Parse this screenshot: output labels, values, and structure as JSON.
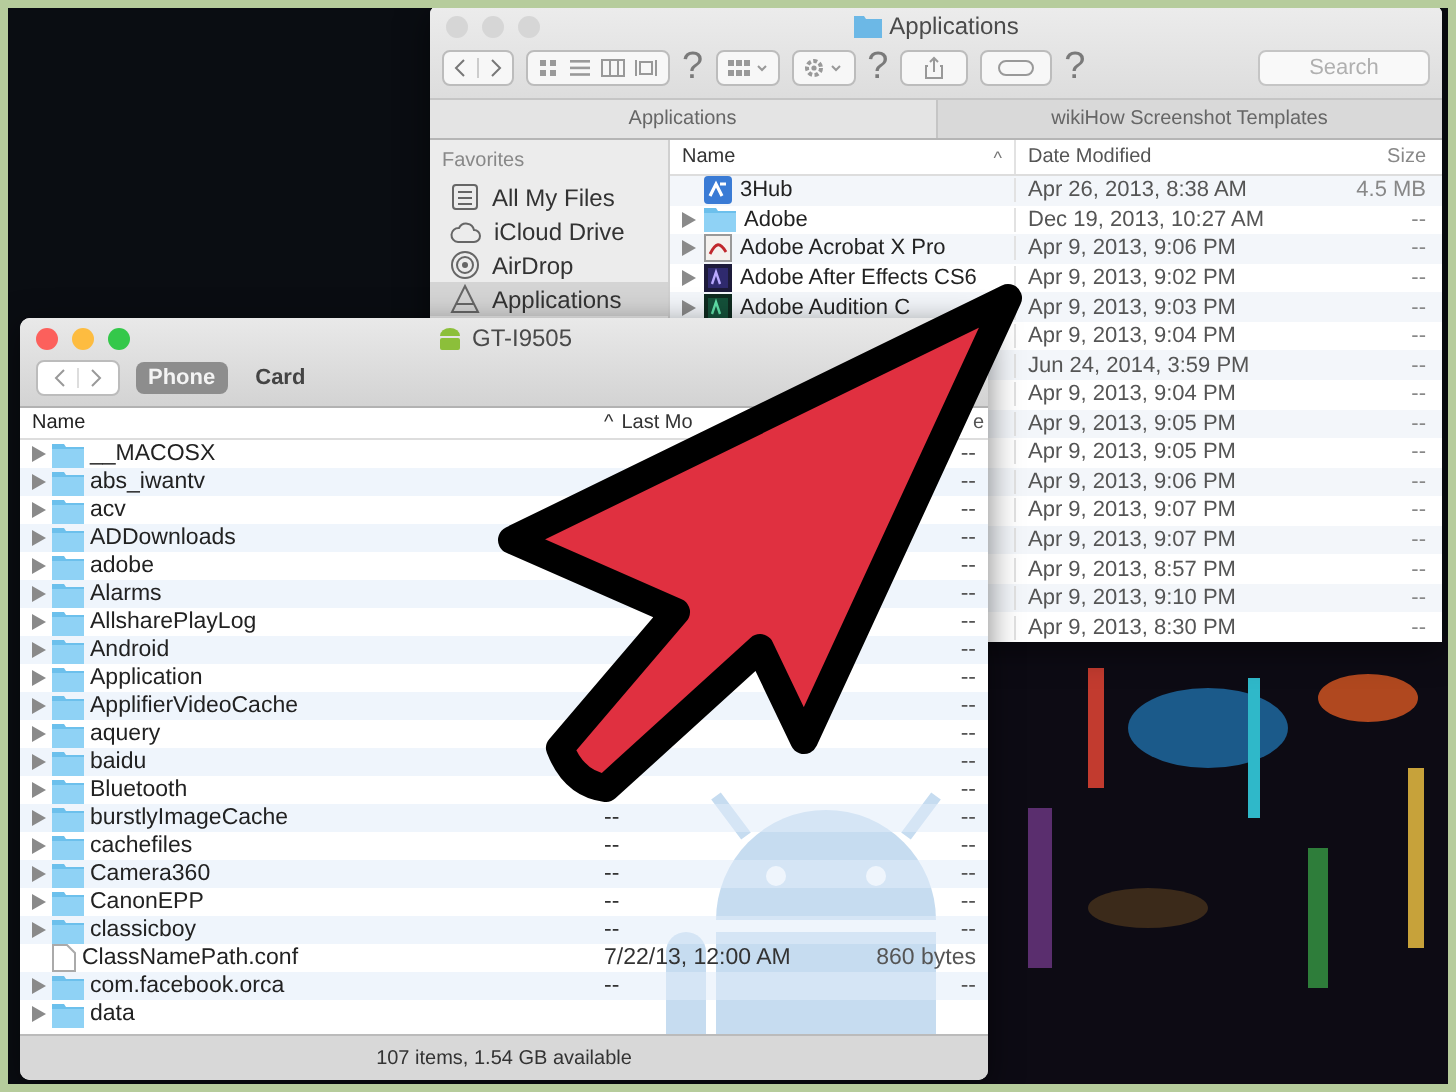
{
  "finder": {
    "title": "Applications",
    "toolbar": [
      {
        "kind": "nav"
      },
      {
        "kind": "views"
      },
      {
        "kind": "mark",
        "text": "?"
      },
      {
        "kind": "arrange"
      },
      {
        "kind": "action"
      },
      {
        "kind": "mark",
        "text": "?"
      },
      {
        "kind": "share"
      },
      {
        "kind": "tag"
      },
      {
        "kind": "mark",
        "text": "?"
      }
    ],
    "search": {
      "placeholder": "Search"
    },
    "path_tabs": [
      "Applications",
      "wikiHow Screenshot Templates"
    ],
    "sidebar": {
      "heading": "Favorites",
      "items": [
        {
          "label": "All My Files",
          "kind": "files",
          "selected": false
        },
        {
          "label": "iCloud Drive",
          "kind": "cloud",
          "selected": false
        },
        {
          "label": "AirDrop",
          "kind": "airdrop",
          "selected": false
        },
        {
          "label": "Applications",
          "kind": "apps",
          "selected": true
        }
      ]
    },
    "columns": [
      "Name",
      "Date Modified",
      "Size"
    ],
    "sort_mark": "^",
    "rows": [
      {
        "kind": "app",
        "name": "3Hub",
        "date": "Apr 26, 2013, 8:38 AM",
        "size": "4.5 MB"
      },
      {
        "kind": "folder",
        "name": "Adobe",
        "date": "Dec 19, 2013, 10:27 AM",
        "size": "--"
      },
      {
        "kind": "pdf",
        "name": "Adobe Acrobat X Pro",
        "date": "Apr 9, 2013, 9:06 PM",
        "size": "--"
      },
      {
        "kind": "ae",
        "name": "Adobe After Effects CS6",
        "date": "Apr 9, 2013, 9:02 PM",
        "size": "--"
      },
      {
        "kind": "au",
        "name": "Adobe Audition C",
        "date": "Apr 9, 2013, 9:03 PM",
        "size": "--"
      },
      {
        "date": "Apr 9, 2013, 9:04 PM",
        "size": "--"
      },
      {
        "date": "Jun 24, 2014, 3:59 PM",
        "size": "--"
      },
      {
        "date": "Apr 9, 2013, 9:04 PM",
        "size": "--"
      },
      {
        "date": "Apr 9, 2013, 9:05 PM",
        "size": "--"
      },
      {
        "date": "Apr 9, 2013, 9:05 PM",
        "size": "--"
      },
      {
        "date": "Apr 9, 2013, 9:06 PM",
        "size": "--"
      },
      {
        "date": "Apr 9, 2013, 9:07 PM",
        "size": "--"
      },
      {
        "date": "Apr 9, 2013, 9:07 PM",
        "size": "--"
      },
      {
        "date": "Apr 9, 2013, 8:57 PM",
        "size": "--"
      },
      {
        "date": "Apr 9, 2013, 9:10 PM",
        "size": "--"
      },
      {
        "date": "Apr 9, 2013, 8:30 PM",
        "size": "--"
      }
    ]
  },
  "transfer": {
    "title": "GT-I9505",
    "tabs": [
      {
        "label": "Phone",
        "selected": true
      },
      {
        "label": "Card",
        "selected": false
      }
    ],
    "columns": [
      "Name",
      "Last Mo",
      "e"
    ],
    "sort_mark": "^",
    "rows": [
      {
        "kind": "folder",
        "name": "__MACOSX",
        "size": "--"
      },
      {
        "kind": "folder",
        "name": "abs_iwantv",
        "size": "--"
      },
      {
        "kind": "folder",
        "name": "acv",
        "size": "--"
      },
      {
        "kind": "folder",
        "name": "ADDownloads",
        "size": "--"
      },
      {
        "kind": "folder",
        "name": "adobe",
        "size": "--"
      },
      {
        "kind": "folder",
        "name": "Alarms",
        "size": "--"
      },
      {
        "kind": "folder",
        "name": "AllsharePlayLog",
        "size": "--"
      },
      {
        "kind": "folder",
        "name": "Android",
        "size": "--"
      },
      {
        "kind": "folder",
        "name": "Application",
        "size": "--"
      },
      {
        "kind": "folder",
        "name": "ApplifierVideoCache",
        "size": "--"
      },
      {
        "kind": "folder",
        "name": "aquery",
        "size": "--"
      },
      {
        "kind": "folder",
        "name": "baidu",
        "size": "--"
      },
      {
        "kind": "folder",
        "name": "Bluetooth",
        "size": "--"
      },
      {
        "kind": "folder",
        "name": "burstlyImageCache",
        "modified": "--",
        "size": "--"
      },
      {
        "kind": "folder",
        "name": "cachefiles",
        "modified": "--",
        "size": "--"
      },
      {
        "kind": "folder",
        "name": "Camera360",
        "modified": "--",
        "size": "--"
      },
      {
        "kind": "folder",
        "name": "CanonEPP",
        "modified": "--",
        "size": "--"
      },
      {
        "kind": "folder",
        "name": "classicboy",
        "modified": "--",
        "size": "--"
      },
      {
        "kind": "file",
        "name": "ClassNamePath.conf",
        "modified": "7/22/13, 12:00 AM",
        "size": "860 bytes"
      },
      {
        "kind": "folder",
        "name": "com.facebook.orca",
        "modified": "--",
        "size": "--"
      },
      {
        "kind": "folder",
        "name": "data"
      }
    ],
    "status": "107 items, 1.54 GB available"
  }
}
